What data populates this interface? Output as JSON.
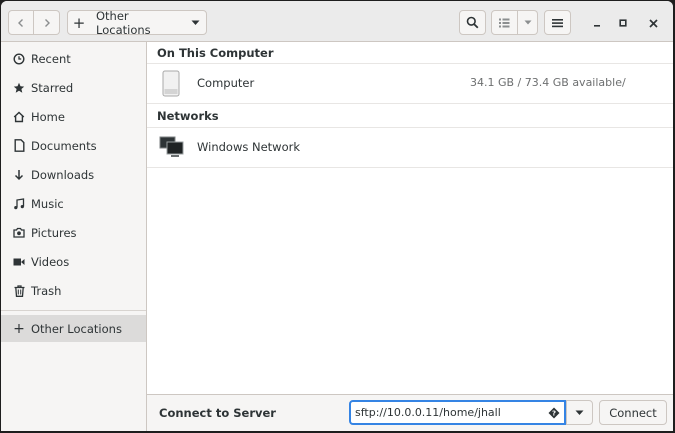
{
  "window": {
    "title": "Other Locations"
  },
  "header": {
    "back_icon": "chevron-left-icon",
    "forward_icon": "chevron-right-icon",
    "path": {
      "prefix_icon": "plus-icon",
      "location": "Other Locations"
    },
    "search_icon": "search-icon",
    "view_icon": "list-view-icon",
    "menu_icon": "hamburger-menu-icon",
    "controls": {
      "minimize_icon": "minimize-icon",
      "maximize_icon": "maximize-icon",
      "close_icon": "close-icon"
    }
  },
  "sidebar": {
    "items": [
      {
        "label": "Recent",
        "icon": "clock-icon"
      },
      {
        "label": "Starred",
        "icon": "star-icon"
      },
      {
        "label": "Home",
        "icon": "home-icon"
      },
      {
        "label": "Documents",
        "icon": "document-icon"
      },
      {
        "label": "Downloads",
        "icon": "download-icon"
      },
      {
        "label": "Music",
        "icon": "music-icon"
      },
      {
        "label": "Pictures",
        "icon": "camera-icon"
      },
      {
        "label": "Videos",
        "icon": "video-icon"
      },
      {
        "label": "Trash",
        "icon": "trash-icon"
      },
      {
        "label": "Other Locations",
        "icon": "plus-icon",
        "selected": true
      }
    ]
  },
  "main": {
    "sections": [
      {
        "title": "On This Computer",
        "rows": [
          {
            "name": "Computer",
            "space": "34.1 GB / 73.4 GB available",
            "mount": "/",
            "icon": "drive-icon"
          }
        ]
      },
      {
        "title": "Networks",
        "rows": [
          {
            "name": "Windows Network",
            "icon": "network-icon"
          }
        ]
      }
    ]
  },
  "actionbar": {
    "label": "Connect to Server",
    "server_value": "sftp://10.0.0.11/home/jhall",
    "help_icon": "help-icon",
    "dropdown_icon": "chevron-down-icon",
    "connect_label": "Connect"
  },
  "colors": {
    "accent": "#3584e4",
    "selected_row": "#dcdbda",
    "header_bg": "#ebebeb"
  }
}
